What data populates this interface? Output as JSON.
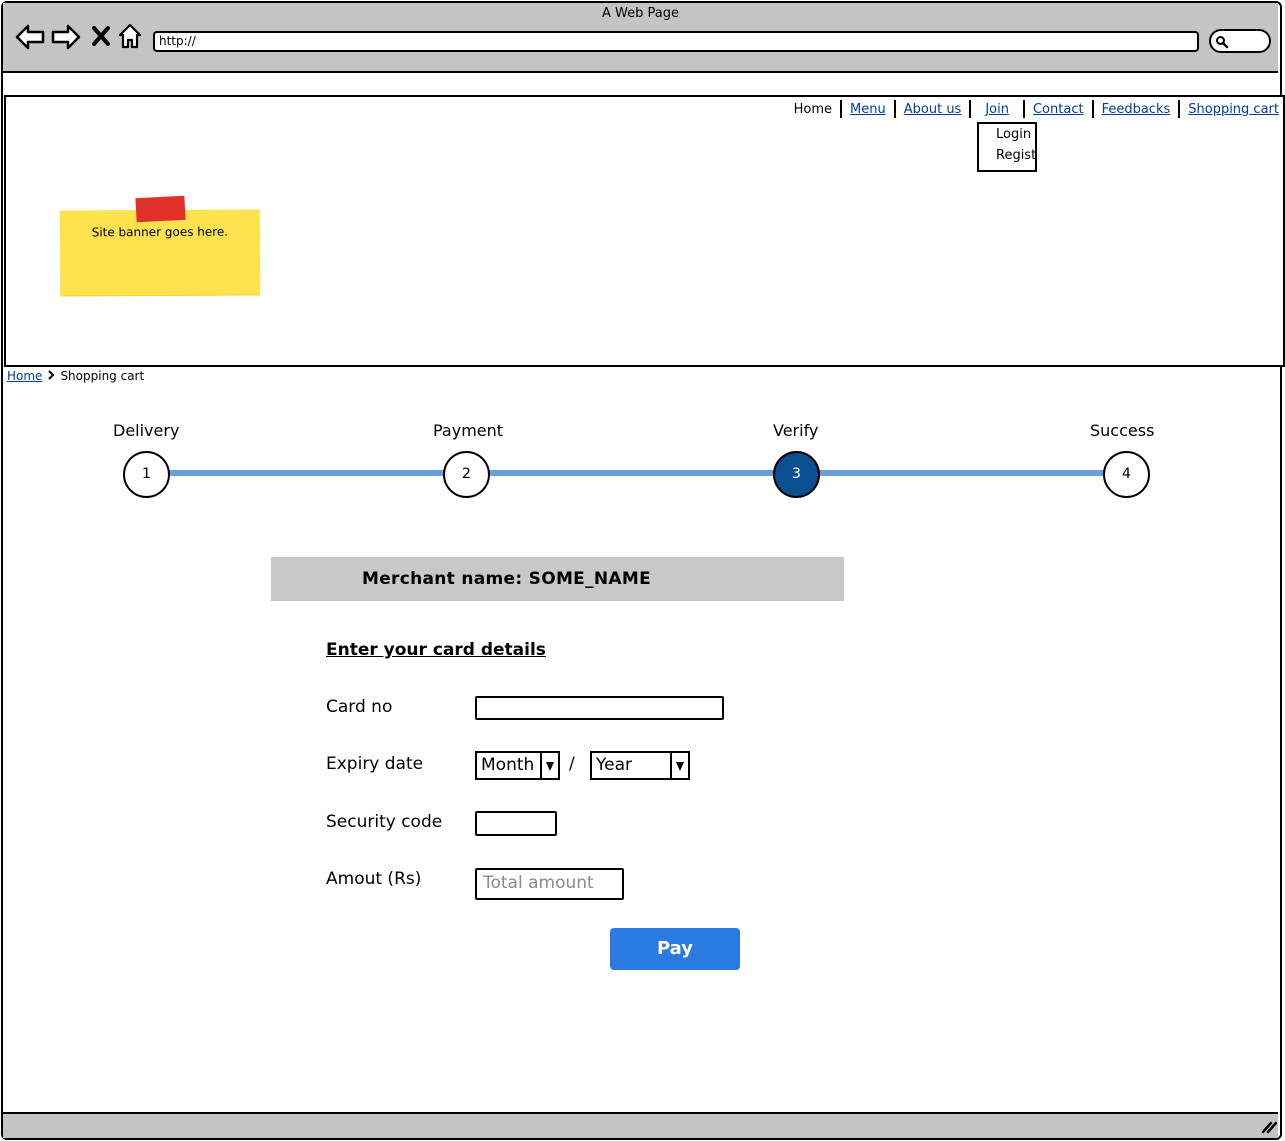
{
  "window": {
    "title": "A Web Page",
    "url": "http://"
  },
  "nav": {
    "items": [
      {
        "label": "Home",
        "current": true
      },
      {
        "label": "Menu"
      },
      {
        "label": "About us"
      },
      {
        "label": "Join"
      },
      {
        "label": "Contact"
      },
      {
        "label": "Feedbacks"
      },
      {
        "label": "Shopping cart"
      }
    ],
    "join_menu": [
      "Login",
      "Regist"
    ]
  },
  "banner": {
    "text": "Site banner goes here."
  },
  "breadcrumb": {
    "home": "Home",
    "current": "Shopping cart"
  },
  "stepper": {
    "steps": [
      {
        "label": "Delivery",
        "number": "1"
      },
      {
        "label": "Payment",
        "number": "2"
      },
      {
        "label": "Verify",
        "number": "3"
      },
      {
        "label": "Success",
        "number": "4"
      }
    ],
    "active_step": 3,
    "colors": {
      "line": "#6aa0d8",
      "active": "#0b4f90"
    }
  },
  "merchant": {
    "label": "Merchant name: SOME_NAME"
  },
  "form": {
    "heading": "Enter your card details",
    "card_no_label": "Card no",
    "expiry_label": "Expiry date",
    "month_value": "Month",
    "slash": "/",
    "year_value": "Year",
    "security_label": "Security code",
    "amount_label": "Amout (Rs)",
    "amount_placeholder": "Total amount",
    "pay_label": "Pay"
  },
  "colors": {
    "pay_button": "#2a7ae2",
    "chrome": "#c4c4c4",
    "link": "#003d99",
    "sticky_note": "#ffe24e",
    "tape": "#e0302a"
  }
}
